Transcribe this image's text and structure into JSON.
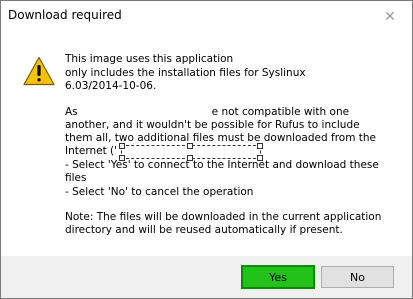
{
  "window": {
    "title": "Download required",
    "close_glyph": "✕"
  },
  "icon": "warning-triangle-icon",
  "message": {
    "para1_line1_a": "This image uses",
    "para1_line1_faint": "                        ",
    "para1_line1_b": "this application",
    "para1_line2": "only includes the installation files for Syslinux",
    "para1_line3": "6.03/2014-10-06.",
    "para2_line1_a": "As",
    "para2_line1_b": "e not compatible with one",
    "para2_line2": "another, and it wouldn't be possible for Rufus to include",
    "para2_line3": "them all, two additional files must be downloaded from the",
    "para2_line4": "Internet ('",
    "para2_line5": "- Select 'Yes' to connect to the Internet and download these",
    "para2_line6": "files",
    "para2_line7": "- Select 'No' to cancel the operation",
    "para3_line1": "Note: The files will be downloaded in the current application",
    "para3_line2": "directory and will be reused automatically if present."
  },
  "buttons": {
    "yes": "Yes",
    "no": "No"
  },
  "colors": {
    "yes_highlight": "#22c21b",
    "warning_fill": "#f5c400"
  }
}
